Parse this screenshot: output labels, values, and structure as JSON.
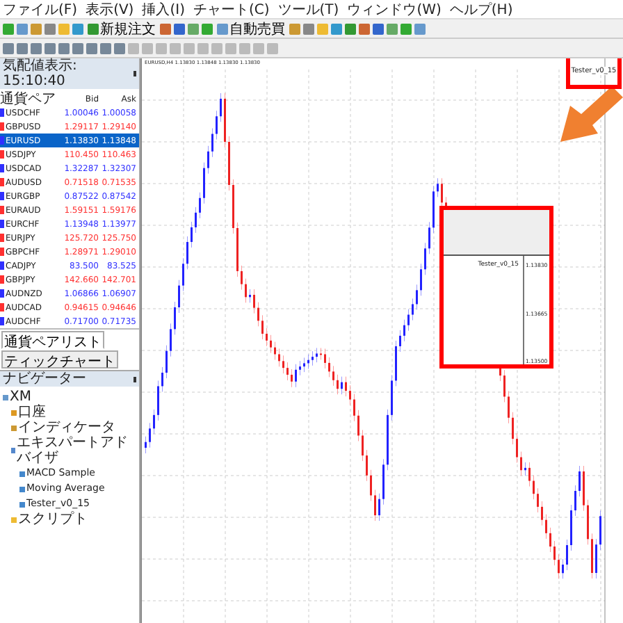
{
  "menu": [
    "ファイル(F)",
    "表示(V)",
    "挿入(I)",
    "チャート(C)",
    "ツール(T)",
    "ウィンドウ(W)",
    "ヘルプ(H)"
  ],
  "toolbar": {
    "buttons": [
      "新規注文",
      "自動売買"
    ]
  },
  "market_watch": {
    "title": "気配値表示: 15:10:40",
    "columns": [
      "通貨ペア",
      "Bid",
      "Ask"
    ],
    "rows": [
      {
        "symbol": "USDCHF",
        "bid": "1.00046",
        "ask": "1.00058",
        "color": "#3030ff",
        "selected": false
      },
      {
        "symbol": "GBPUSD",
        "bid": "1.29117",
        "ask": "1.29140",
        "color": "#ff3030",
        "selected": false
      },
      {
        "symbol": "EURUSD",
        "bid": "1.13830",
        "ask": "1.13848",
        "color": "#3030ff",
        "selected": true
      },
      {
        "symbol": "USDJPY",
        "bid": "110.450",
        "ask": "110.463",
        "color": "#ff3030",
        "selected": false
      },
      {
        "symbol": "USDCAD",
        "bid": "1.32287",
        "ask": "1.32307",
        "color": "#3030ff",
        "selected": false
      },
      {
        "symbol": "AUDUSD",
        "bid": "0.71518",
        "ask": "0.71535",
        "color": "#ff3030",
        "selected": false
      },
      {
        "symbol": "EURGBP",
        "bid": "0.87522",
        "ask": "0.87542",
        "color": "#3030ff",
        "selected": false
      },
      {
        "symbol": "EURAUD",
        "bid": "1.59151",
        "ask": "1.59176",
        "color": "#ff3030",
        "selected": false
      },
      {
        "symbol": "EURCHF",
        "bid": "1.13948",
        "ask": "1.13977",
        "color": "#3030ff",
        "selected": false
      },
      {
        "symbol": "EURJPY",
        "bid": "125.720",
        "ask": "125.750",
        "color": "#ff3030",
        "selected": false
      },
      {
        "symbol": "GBPCHF",
        "bid": "1.28971",
        "ask": "1.29010",
        "color": "#ff3030",
        "selected": false
      },
      {
        "symbol": "CADJPY",
        "bid": "83.500",
        "ask": "83.525",
        "color": "#3030ff",
        "selected": false
      },
      {
        "symbol": "GBPJPY",
        "bid": "142.660",
        "ask": "142.701",
        "color": "#ff3030",
        "selected": false
      },
      {
        "symbol": "AUDNZD",
        "bid": "1.06866",
        "ask": "1.06907",
        "color": "#3030ff",
        "selected": false
      },
      {
        "symbol": "AUDCAD",
        "bid": "0.94615",
        "ask": "0.94646",
        "color": "#ff3030",
        "selected": false
      },
      {
        "symbol": "AUDCHF",
        "bid": "0.71700",
        "ask": "0.71735",
        "color": "#3030ff",
        "selected": false
      }
    ],
    "tabs": [
      {
        "label": "通貨ペアリスト",
        "selected": true
      },
      {
        "label": "ティックチャート",
        "selected": false
      }
    ]
  },
  "navigator": {
    "title": "ナビゲーター",
    "tree": [
      {
        "label": "XM",
        "children": [
          {
            "label": "口座",
            "kind": "account"
          },
          {
            "label": "インディケータ",
            "kind": "indicator"
          },
          {
            "label": "エキスパートアドバイザ",
            "kind": "expert",
            "children": [
              {
                "label": "MACD Sample",
                "kind": "ea"
              },
              {
                "label": "Moving Average",
                "kind": "ea"
              },
              {
                "label": "Tester_v0_15",
                "kind": "ea"
              }
            ]
          },
          {
            "label": "スクリプト",
            "kind": "script"
          }
        ]
      }
    ]
  },
  "chart": {
    "title": "EURUSD,H4 1.13830 1.13848 1.13830 1.13830",
    "ea_label": "Tester_v0_15",
    "inset": {
      "ea_label": "Tester_v0_15",
      "prices": [
        "1.13830",
        "1.13665",
        "1.13500"
      ]
    }
  }
}
